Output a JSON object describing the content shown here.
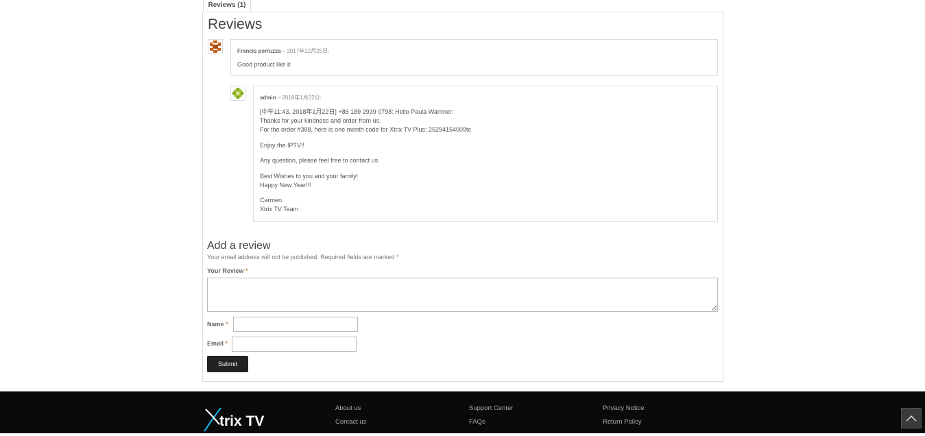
{
  "tabs": {
    "reviews_label": "Reviews (1)"
  },
  "reviews_heading": "Reviews",
  "comments": [
    {
      "author": "Francis perruzza",
      "date": "– 2017年12月25日:",
      "paragraphs": [
        "Good product like it"
      ]
    },
    {
      "author": "admin",
      "date": "– 2018年1月22日:",
      "paragraphs": [
        "[中午11:43, 2018年1月22日] +86 189 2939 0798: Hello Paula Warriner:",
        "Thanks for your kindness and order from us.",
        "For the order #388, here is one month code for Xtrix TV Plus: 25294154009tc",
        "Enjoy the IPTV!!",
        "Any question, please feel free to contact us.",
        "Best Wishes to you and your family!",
        "Happy New Year!!!",
        "Carmen",
        "Xtrix TV Team"
      ]
    }
  ],
  "add_review": {
    "heading": "Add a review",
    "note": "Your email address will not be published. Required fields are marked",
    "required_mark": "*",
    "review_label": "Your Review",
    "name_label": "Name",
    "email_label": "Email",
    "review_value": "",
    "name_value": "",
    "email_value": "",
    "submit_label": "Submit"
  },
  "footer": {
    "logo_text_x": "X",
    "logo_text_rest": "trix TV",
    "links": {
      "about": "About us",
      "contact": "Contact us",
      "support": "Support Center",
      "faqs": "FAQs",
      "privacy": "Privacy Notice",
      "returns": "Return Policy"
    }
  },
  "icons": {
    "avatar1": "identicon-orange",
    "avatar2": "identicon-green",
    "scroll_top": "chevron-up-icon"
  },
  "colors": {
    "footer_bg": "#0a0a0a",
    "submit_bg": "#222222",
    "logo_accent": "#1ab0e8"
  }
}
